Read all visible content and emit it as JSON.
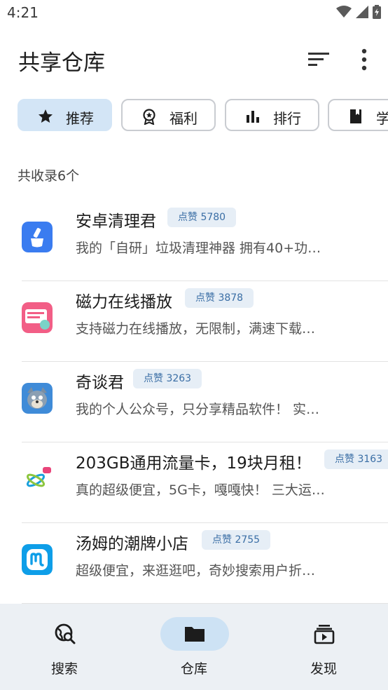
{
  "status_bar": {
    "time": "4:21"
  },
  "header": {
    "title": "共享仓库"
  },
  "chips": [
    {
      "label": "推荐",
      "icon": "star-icon",
      "active": true
    },
    {
      "label": "福利",
      "icon": "award-icon",
      "active": false
    },
    {
      "label": "排行",
      "icon": "bar-chart-icon",
      "active": false
    },
    {
      "label": "学",
      "icon": "book-icon",
      "active": false
    }
  ],
  "summary": {
    "count_text": "共收录6个"
  },
  "items": [
    {
      "name": "安卓清理君",
      "badge": "点赞 5780",
      "desc": "我的「自研」垃圾清理神器 拥有40+功…"
    },
    {
      "name": "磁力在线播放",
      "badge": "点赞 3878",
      "desc": "支持磁力在线播放，无限制，满速下载…"
    },
    {
      "name": "奇谈君",
      "badge": "点赞 3263",
      "desc": "我的个人公众号，只分享精品软件！ 实…"
    },
    {
      "name": "203GB通用流量卡，19块月租！",
      "badge": "点赞 3163",
      "desc": "真的超级便宜，5G卡，嘎嘎快！ 三大运…"
    },
    {
      "name": "汤姆的潮牌小店",
      "badge": "点赞 2755",
      "desc": "超级便宜，来逛逛吧，奇妙搜索用户折…"
    }
  ],
  "bottom_nav": [
    {
      "label": "搜索",
      "icon": "search-globe-icon",
      "active": false
    },
    {
      "label": "仓库",
      "icon": "folder-icon",
      "active": true
    },
    {
      "label": "发现",
      "icon": "play-box-icon",
      "active": false
    }
  ],
  "colors": {
    "accent_bg": "#d3e5f6",
    "badge_bg": "#e6eef6",
    "badge_text": "#3a6ea5",
    "bottom_bg": "#ecf0f4"
  }
}
